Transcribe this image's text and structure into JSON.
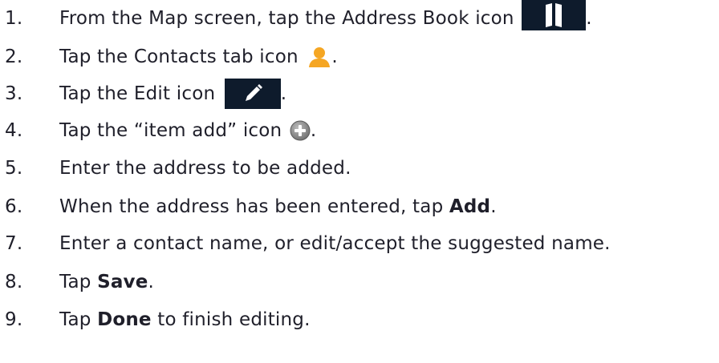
{
  "steps": [
    {
      "number": "1.",
      "parts": [
        {
          "type": "text",
          "value": "From the Map screen, tap the Address Book icon "
        },
        {
          "type": "icon",
          "icon": "address-book-icon"
        },
        {
          "type": "text",
          "value": "."
        }
      ]
    },
    {
      "number": "2.",
      "parts": [
        {
          "type": "text",
          "value": "Tap the Contacts tab icon "
        },
        {
          "type": "icon",
          "icon": "contacts-person-icon"
        },
        {
          "type": "text",
          "value": "."
        }
      ]
    },
    {
      "number": "3.",
      "parts": [
        {
          "type": "text",
          "value": "Tap the Edit icon "
        },
        {
          "type": "icon",
          "icon": "edit-pencil-icon"
        },
        {
          "type": "text",
          "value": "."
        }
      ]
    },
    {
      "number": "4.",
      "parts": [
        {
          "type": "text",
          "value": "Tap the “item add” icon "
        },
        {
          "type": "icon",
          "icon": "item-add-icon"
        },
        {
          "type": "text",
          "value": "."
        }
      ]
    },
    {
      "number": "5.",
      "parts": [
        {
          "type": "text",
          "value": "Enter the address to be added."
        }
      ]
    },
    {
      "number": "6.",
      "parts": [
        {
          "type": "text",
          "value": "When the address has been entered, tap "
        },
        {
          "type": "bold",
          "value": "Add"
        },
        {
          "type": "text",
          "value": "."
        }
      ]
    },
    {
      "number": "7.",
      "parts": [
        {
          "type": "text",
          "value": "Enter a contact name, or edit/accept the suggested name."
        }
      ]
    },
    {
      "number": "8.",
      "parts": [
        {
          "type": "text",
          "value": "Tap "
        },
        {
          "type": "bold",
          "value": "Save"
        },
        {
          "type": "text",
          "value": "."
        }
      ]
    },
    {
      "number": "9.",
      "parts": [
        {
          "type": "text",
          "value": "Tap "
        },
        {
          "type": "bold",
          "value": "Done"
        },
        {
          "type": "text",
          "value": " to finish editing."
        }
      ]
    }
  ],
  "colors": {
    "text": "#1f1f2a",
    "icon_dark_bg": "#0e1b2c",
    "icon_white": "#ffffff",
    "person_orange": "#f5a623",
    "add_gray": "#8a8a8a"
  }
}
